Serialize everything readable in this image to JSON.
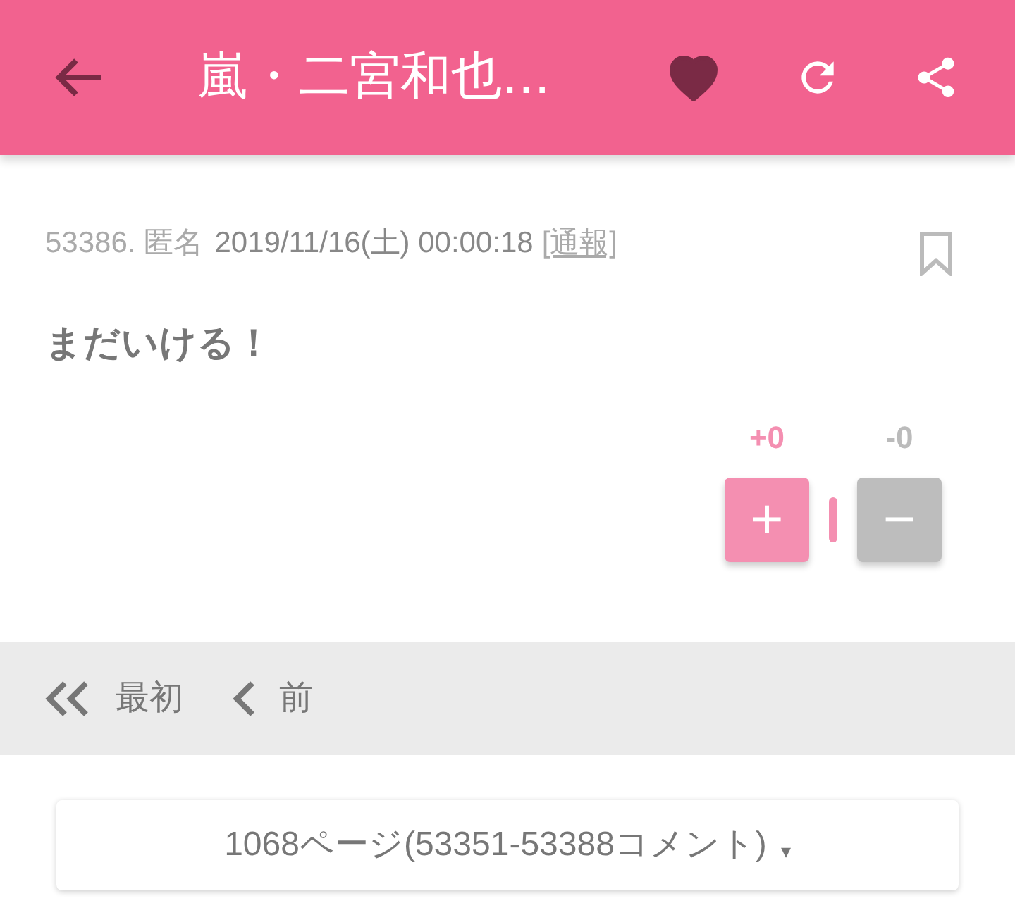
{
  "header": {
    "title": "嵐・二宮和也...",
    "favorited": true
  },
  "comment": {
    "number": "53386.",
    "author": "匿名",
    "datetime": "2019/11/16(土) 00:00:18",
    "report": "[通報]",
    "body": "まだいける！",
    "votes": [
      {
        "kind": "plus",
        "count": "+0",
        "symbol": "+"
      },
      {
        "kind": "minus",
        "count": "-0",
        "symbol": "−"
      }
    ]
  },
  "pager": [
    {
      "kind": "first",
      "label": "最初"
    },
    {
      "kind": "prev",
      "label": "前"
    }
  ],
  "page_select": {
    "value": "1068ページ(53351-53388コメント)",
    "caret": "▾"
  }
}
